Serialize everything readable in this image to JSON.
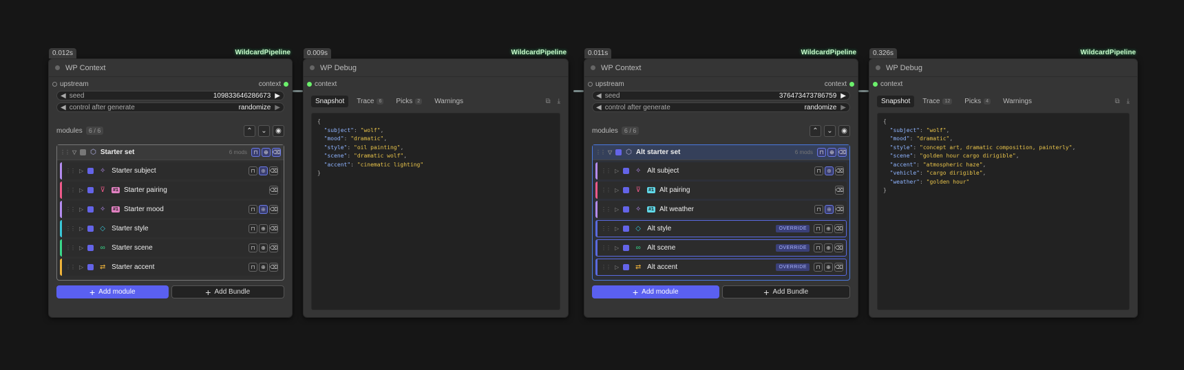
{
  "nodes": [
    {
      "type": "context",
      "time": "0.012s",
      "pipeline": "WildcardPipeline",
      "title": "WP Context",
      "input_label": "upstream",
      "output_label": "context",
      "seed_label": "seed",
      "seed_value": "109833646286673",
      "control_label": "control after generate",
      "control_value": "randomize",
      "modules_label": "modules",
      "modules_count": "6 / 6",
      "group": {
        "name": "Starter set",
        "mods": "6 mods",
        "highlighted": false,
        "rows": [
          {
            "name": "Starter subject",
            "icon": "sparkles-icon",
            "glyph": "✧",
            "color": "#b48cf0",
            "tag": "",
            "override": false,
            "globe": true,
            "lock": true
          },
          {
            "name": "Starter pairing",
            "icon": "funnel-icon",
            "glyph": "⊽",
            "color": "#f05a8a",
            "tag": "#1",
            "override": false,
            "globe": false,
            "lock": false
          },
          {
            "name": "Starter mood",
            "icon": "sparkles-icon",
            "glyph": "✧",
            "color": "#b48cf0",
            "tag": "#1",
            "override": false,
            "globe": true,
            "lock": true
          },
          {
            "name": "Starter style",
            "icon": "tag-icon",
            "glyph": "◇",
            "color": "#3ac8d8",
            "tag": "",
            "override": false,
            "globe": false,
            "lock": true
          },
          {
            "name": "Starter scene",
            "icon": "link-icon",
            "glyph": "∞",
            "color": "#3ad88a",
            "tag": "",
            "override": false,
            "globe": false,
            "lock": true
          },
          {
            "name": "Starter accent",
            "icon": "swap-icon",
            "glyph": "⇄",
            "color": "#f0b43a",
            "tag": "",
            "override": false,
            "globe": false,
            "lock": true
          }
        ]
      },
      "add_module": "Add module",
      "add_bundle": "Add Bundle"
    },
    {
      "type": "debug",
      "time": "0.009s",
      "pipeline": "WildcardPipeline",
      "title": "WP Debug",
      "input_label": "context",
      "tabs": [
        {
          "label": "Snapshot",
          "count": "",
          "active": true
        },
        {
          "label": "Trace",
          "count": "6",
          "active": false
        },
        {
          "label": "Picks",
          "count": "2",
          "active": false
        },
        {
          "label": "Warnings",
          "count": "",
          "active": false
        }
      ],
      "snapshot": [
        {
          "key": "\"subject\"",
          "value": "\"wolf\""
        },
        {
          "key": "\"mood\"",
          "value": "\"dramatic\""
        },
        {
          "key": "\"style\"",
          "value": "\"oil painting\""
        },
        {
          "key": "\"scene\"",
          "value": "\"dramatic wolf\""
        },
        {
          "key": "\"accent\"",
          "value": "\"cinematic lighting\""
        }
      ]
    },
    {
      "type": "context",
      "time": "0.011s",
      "pipeline": "WildcardPipeline",
      "title": "WP Context",
      "input_label": "upstream",
      "output_label": "context",
      "seed_label": "seed",
      "seed_value": "376473473786759",
      "control_label": "control after generate",
      "control_value": "randomize",
      "modules_label": "modules",
      "modules_count": "6 / 6",
      "group": {
        "name": "Alt starter set",
        "mods": "6 mods",
        "highlighted": true,
        "rows": [
          {
            "name": "Alt subject",
            "icon": "sparkles-icon",
            "glyph": "✧",
            "color": "#b48cf0",
            "tag": "",
            "override": false,
            "globe": true,
            "lock": true
          },
          {
            "name": "Alt pairing",
            "icon": "funnel-icon",
            "glyph": "⊽",
            "color": "#f05a8a",
            "tag": "#1",
            "override": false,
            "globe": false,
            "lock": false
          },
          {
            "name": "Alt weather",
            "icon": "sparkles-icon",
            "glyph": "✧",
            "color": "#b48cf0",
            "tag": "#1",
            "override": false,
            "globe": true,
            "lock": true
          },
          {
            "name": "Alt style",
            "icon": "tag-icon",
            "glyph": "◇",
            "color": "#3ac8d8",
            "tag": "",
            "override": true,
            "globe": false,
            "lock": true
          },
          {
            "name": "Alt scene",
            "icon": "link-icon",
            "glyph": "∞",
            "color": "#3ad88a",
            "tag": "",
            "override": true,
            "globe": false,
            "lock": true
          },
          {
            "name": "Alt accent",
            "icon": "swap-icon",
            "glyph": "⇄",
            "color": "#f0b43a",
            "tag": "",
            "override": true,
            "globe": false,
            "lock": true
          }
        ]
      },
      "add_module": "Add module",
      "add_bundle": "Add Bundle"
    },
    {
      "type": "debug",
      "time": "0.326s",
      "pipeline": "WildcardPipeline",
      "title": "WP Debug",
      "input_label": "context",
      "tabs": [
        {
          "label": "Snapshot",
          "count": "",
          "active": true
        },
        {
          "label": "Trace",
          "count": "12",
          "active": false
        },
        {
          "label": "Picks",
          "count": "4",
          "active": false
        },
        {
          "label": "Warnings",
          "count": "",
          "active": false
        }
      ],
      "snapshot": [
        {
          "key": "\"subject\"",
          "value": "\"wolf\""
        },
        {
          "key": "\"mood\"",
          "value": "\"dramatic\""
        },
        {
          "key": "\"style\"",
          "value": "\"concept art, dramatic composition, painterly\""
        },
        {
          "key": "\"scene\"",
          "value": "\"golden hour cargo dirigible\""
        },
        {
          "key": "\"accent\"",
          "value": "\"atmospheric haze\""
        },
        {
          "key": "\"vehicle\"",
          "value": "\"cargo dirigible\""
        },
        {
          "key": "\"weather\"",
          "value": "\"golden hour\""
        }
      ]
    }
  ],
  "override_label": "OVERRIDE",
  "colors": {
    "accent": "#5a60f0",
    "highlight_border": "#4a7ae0",
    "link_pin": "#6cf06c"
  }
}
